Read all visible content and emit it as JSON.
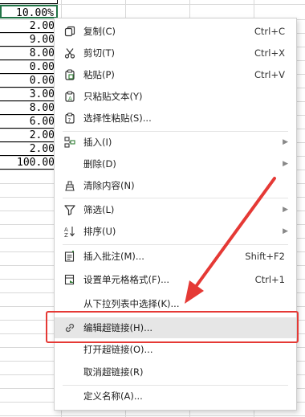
{
  "sheet": {
    "active_cell": "10.00%",
    "values": [
      "2.00",
      "9.00",
      "8.00",
      "0.00",
      "0.00",
      "3.00",
      "8.00",
      "6.00",
      "2.00",
      "2.00",
      "100.00"
    ]
  },
  "menu": {
    "items": [
      {
        "label": "复制(C)",
        "shortcut": "Ctrl+C",
        "icon": "copy-icon"
      },
      {
        "label": "剪切(T)",
        "shortcut": "Ctrl+X",
        "icon": "scissors-icon"
      },
      {
        "label": "粘贴(P)",
        "shortcut": "Ctrl+V",
        "icon": "paste-icon"
      },
      {
        "label": "只粘贴文本(Y)",
        "shortcut": "",
        "icon": "paste-text-icon"
      },
      {
        "label": "选择性粘贴(S)...",
        "shortcut": "",
        "icon": "paste-special-icon"
      },
      {
        "label": "插入(I)",
        "shortcut": "",
        "icon": "insert-icon",
        "submenu": true
      },
      {
        "label": "删除(D)",
        "shortcut": "",
        "icon": "",
        "submenu": true
      },
      {
        "label": "清除内容(N)",
        "shortcut": "",
        "icon": "eraser-icon"
      },
      {
        "label": "筛选(L)",
        "shortcut": "",
        "icon": "filter-icon",
        "submenu": true
      },
      {
        "label": "排序(U)",
        "shortcut": "",
        "icon": "sort-icon",
        "submenu": true
      },
      {
        "label": "插入批注(M)...",
        "shortcut": "Shift+F2",
        "icon": "comment-icon"
      },
      {
        "label": "设置单元格格式(F)...",
        "shortcut": "Ctrl+1",
        "icon": "format-cells-icon"
      },
      {
        "label": "从下拉列表中选择(K)...",
        "shortcut": "",
        "icon": ""
      },
      {
        "label": "编辑超链接(H)...",
        "shortcut": "",
        "icon": "link-icon",
        "highlighted": true
      },
      {
        "label": "打开超链接(O)...",
        "shortcut": "",
        "icon": ""
      },
      {
        "label": "取消超链接(R)",
        "shortcut": "",
        "icon": ""
      },
      {
        "label": "定义名称(A)...",
        "shortcut": "",
        "icon": ""
      }
    ]
  },
  "annotation_color": "#e53935"
}
